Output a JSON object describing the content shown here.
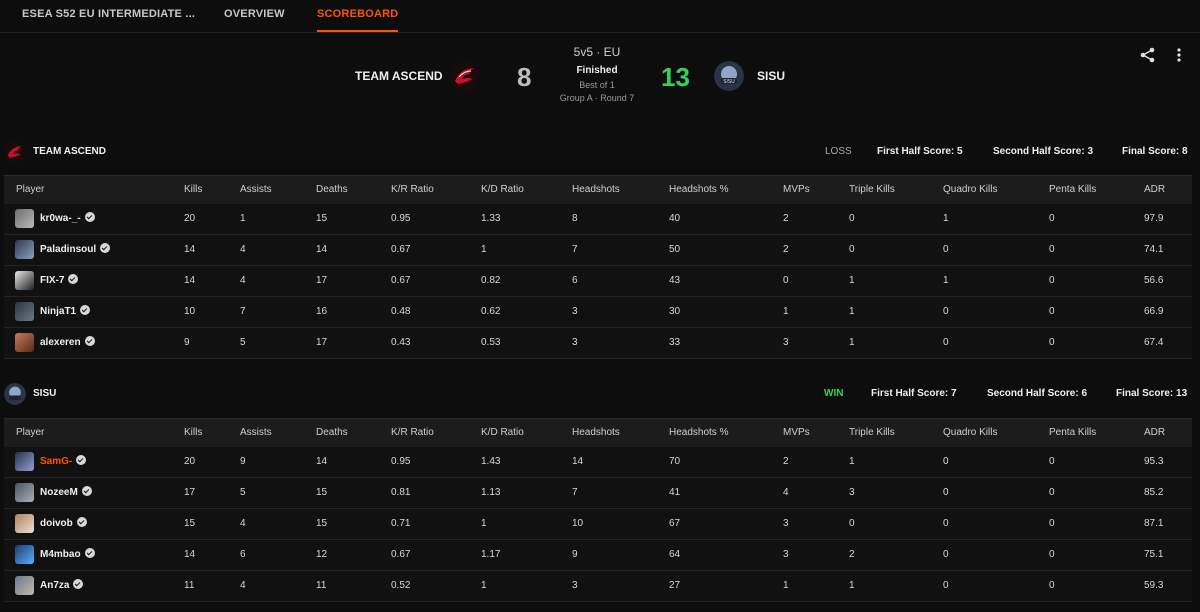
{
  "nav": {
    "tabs": [
      {
        "label": "ESEA S52 EU INTERMEDIATE ..."
      },
      {
        "label": "OVERVIEW"
      },
      {
        "label": "SCOREBOARD"
      }
    ]
  },
  "match": {
    "format": "5v5 · EU",
    "status": "Finished",
    "best_of": "Best of 1",
    "round": "Group A · Round 7",
    "team1": {
      "name": "TEAM ASCEND",
      "score": "8",
      "score_color": "#bdbdbd"
    },
    "team2": {
      "name": "SISU",
      "score": "13",
      "score_color": "#32d35a"
    }
  },
  "icons": {
    "share": "share-icon",
    "more": "more-vertical-icon",
    "verified": "verified-check-icon"
  },
  "colors": {
    "accent": "#ff5500",
    "win": "#32d35a"
  },
  "columns": [
    "Player",
    "Kills",
    "Assists",
    "Deaths",
    "K/R Ratio",
    "K/D Ratio",
    "Headshots",
    "Headshots %",
    "MVPs",
    "Triple Kills",
    "Quadro Kills",
    "Penta Kills",
    "ADR"
  ],
  "teams": [
    {
      "name": "TEAM ASCEND",
      "result": "LOSS",
      "first_half": "First Half Score: 5",
      "second_half": "Second Half Score: 3",
      "final": "Final Score: 8",
      "players": [
        {
          "name": "kr0wa-_-",
          "stats": [
            "20",
            "1",
            "15",
            "0.95",
            "1.33",
            "8",
            "40",
            "2",
            "0",
            "1",
            "0",
            "97.9"
          ]
        },
        {
          "name": "Paladinsoul",
          "stats": [
            "14",
            "4",
            "14",
            "0.67",
            "1",
            "7",
            "50",
            "2",
            "0",
            "0",
            "0",
            "74.1"
          ]
        },
        {
          "name": "FIX-7",
          "stats": [
            "14",
            "4",
            "17",
            "0.67",
            "0.82",
            "6",
            "43",
            "0",
            "1",
            "1",
            "0",
            "56.6"
          ]
        },
        {
          "name": "NinjaT1",
          "stats": [
            "10",
            "7",
            "16",
            "0.48",
            "0.62",
            "3",
            "30",
            "1",
            "1",
            "0",
            "0",
            "66.9"
          ]
        },
        {
          "name": "alexeren",
          "stats": [
            "9",
            "5",
            "17",
            "0.43",
            "0.53",
            "3",
            "33",
            "3",
            "1",
            "0",
            "0",
            "67.4"
          ]
        }
      ]
    },
    {
      "name": "SISU",
      "result": "WIN",
      "first_half": "First Half Score: 7",
      "second_half": "Second Half Score: 6",
      "final": "Final Score: 13",
      "players": [
        {
          "name": "SamG-",
          "highlight": true,
          "stats": [
            "20",
            "9",
            "14",
            "0.95",
            "1.43",
            "14",
            "70",
            "2",
            "1",
            "0",
            "0",
            "95.3"
          ]
        },
        {
          "name": "NozeeM",
          "stats": [
            "17",
            "5",
            "15",
            "0.81",
            "1.13",
            "7",
            "41",
            "4",
            "3",
            "0",
            "0",
            "85.2"
          ]
        },
        {
          "name": "doivob",
          "stats": [
            "15",
            "4",
            "15",
            "0.71",
            "1",
            "10",
            "67",
            "3",
            "0",
            "0",
            "0",
            "87.1"
          ]
        },
        {
          "name": "M4mbao",
          "stats": [
            "14",
            "6",
            "12",
            "0.67",
            "1.17",
            "9",
            "64",
            "3",
            "2",
            "0",
            "0",
            "75.1"
          ]
        },
        {
          "name": "An7za",
          "stats": [
            "11",
            "4",
            "11",
            "0.52",
            "1",
            "3",
            "27",
            "1",
            "1",
            "0",
            "0",
            "59.3"
          ]
        }
      ]
    }
  ]
}
